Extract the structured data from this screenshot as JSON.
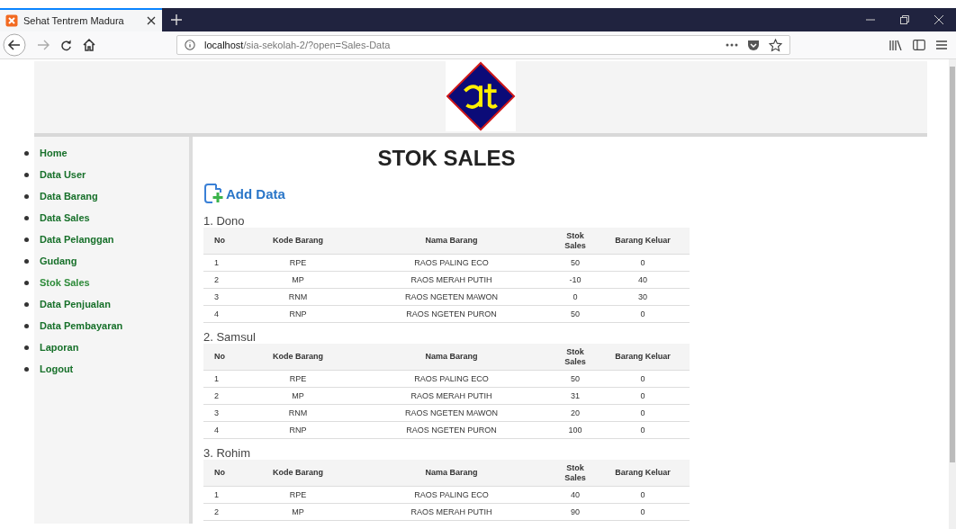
{
  "browser": {
    "tab_title": "Sehat Tentrem Madura",
    "url_host": "localhost",
    "url_path": "/sia-sekolah-2/?open=Sales-Data"
  },
  "sidebar": {
    "items": [
      {
        "label": "Home",
        "selected": false
      },
      {
        "label": "Data User",
        "selected": false
      },
      {
        "label": "Data Barang",
        "selected": false
      },
      {
        "label": "Data Sales",
        "selected": false
      },
      {
        "label": "Data Pelanggan",
        "selected": false
      },
      {
        "label": "Gudang",
        "selected": false
      },
      {
        "label": "Stok Sales",
        "selected": true
      },
      {
        "label": "Data Penjualan",
        "selected": false
      },
      {
        "label": "Data Pembayaran",
        "selected": false
      },
      {
        "label": "Laporan",
        "selected": false
      },
      {
        "label": "Logout",
        "selected": false
      }
    ]
  },
  "page_title": "STOK SALES",
  "add_button": "Add Data",
  "sales": [
    {
      "heading": "1. Dono",
      "columns": [
        "No",
        "Kode Barang",
        "Nama Barang",
        "Stok Sales",
        "Barang Keluar"
      ],
      "rows": [
        [
          "1",
          "RPE",
          "RAOS PALING ECO",
          "50",
          "0"
        ],
        [
          "2",
          "MP",
          "RAOS MERAH PUTIH",
          "-10",
          "40"
        ],
        [
          "3",
          "RNM",
          "RAOS NGETEN MAWON",
          "0",
          "30"
        ],
        [
          "4",
          "RNP",
          "RAOS NGETEN PURON",
          "50",
          "0"
        ]
      ]
    },
    {
      "heading": "2. Samsul",
      "columns": [
        "No",
        "Kode Barang",
        "Nama Barang",
        "Stok Sales",
        "Barang Keluar"
      ],
      "rows": [
        [
          "1",
          "RPE",
          "RAOS PALING ECO",
          "50",
          "0"
        ],
        [
          "2",
          "MP",
          "RAOS MERAH PUTIH",
          "31",
          "0"
        ],
        [
          "3",
          "RNM",
          "RAOS NGETEN MAWON",
          "20",
          "0"
        ],
        [
          "4",
          "RNP",
          "RAOS NGETEN PURON",
          "100",
          "0"
        ]
      ]
    },
    {
      "heading": "3. Rohim",
      "columns": [
        "No",
        "Kode Barang",
        "Nama Barang",
        "Stok Sales",
        "Barang Keluar"
      ],
      "rows": [
        [
          "1",
          "RPE",
          "RAOS PALING ECO",
          "40",
          "0"
        ],
        [
          "2",
          "MP",
          "RAOS MERAH PUTIH",
          "90",
          "0"
        ]
      ]
    }
  ]
}
